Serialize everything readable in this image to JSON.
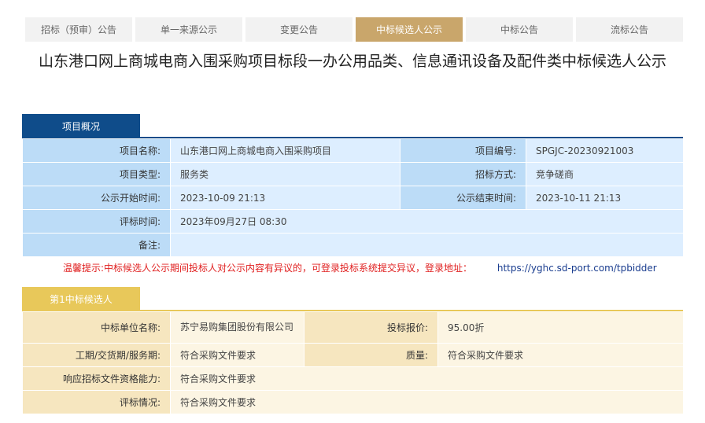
{
  "tabs": [
    {
      "label": "招标（预审）公告"
    },
    {
      "label": "单一来源公示"
    },
    {
      "label": "变更公告"
    },
    {
      "label": "中标候选人公示",
      "active": true
    },
    {
      "label": "中标公告"
    },
    {
      "label": "流标公告"
    }
  ],
  "title": "山东港口网上商城电商入围采购项目标段一办公用品类、信息通讯设备及配件类中标候选人公示",
  "project": {
    "section_label": "项目概况",
    "rows": [
      [
        "项目名称:",
        "山东港口网上商城电商入围采购项目",
        "项目编号:",
        "SPGJC-20230921003"
      ],
      [
        "项目类型:",
        "服务类",
        "招标方式:",
        "竞争磋商"
      ],
      [
        "公示开始时间:",
        "2023-10-09 21:13",
        "公示结束时间:",
        "2023-10-11 21:13"
      ],
      [
        "评标时间:",
        "2023年09月27日 08:30"
      ],
      [
        "备注:",
        ""
      ]
    ]
  },
  "tip": {
    "text": "温馨提示:中标候选人公示期间投标人对公示内容有异议的，可登录投标系统提交异议，登录地址：",
    "url": "https://yghc.sd-port.com/tpbidder"
  },
  "candidate": {
    "section_label": "第1中标候选人",
    "rows": [
      [
        "中标单位名称:",
        "苏宁易购集团股份有限公司",
        "投标报价:",
        "95.00折"
      ],
      [
        "工期/交货期/服务期:",
        "符合采购文件要求",
        "质量:",
        "符合采购文件要求"
      ],
      [
        "响应招标文件资格能力:",
        "符合采购文件要求"
      ],
      [
        "评标情况:",
        "符合采购文件要求"
      ]
    ]
  },
  "colors": {
    "tab_active": "#c9a66b",
    "section_blue": "#0f4c8a",
    "section_gold": "#e8c85a",
    "tip_red": "#e02020"
  }
}
